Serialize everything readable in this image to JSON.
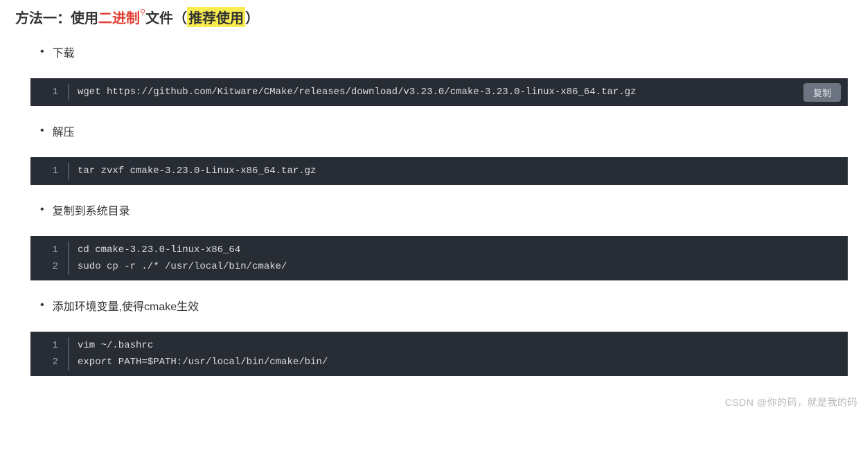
{
  "heading": {
    "prefix": "方法一：使用",
    "keyword": "二进制",
    "afterKeyword": "文件（",
    "highlighted": "推荐使用",
    "suffix": "）"
  },
  "copy_label": "复制",
  "sections": [
    {
      "bullet": "下载",
      "showCopy": true,
      "lines": [
        "wget https://github.com/Kitware/CMake/releases/download/v3.23.0/cmake-3.23.0-linux-x86_64.tar.gz"
      ]
    },
    {
      "bullet": "解压",
      "showCopy": false,
      "lines": [
        "tar zvxf cmake-3.23.0-Linux-x86_64.tar.gz"
      ]
    },
    {
      "bullet": "复制到系统目录",
      "showCopy": false,
      "lines": [
        "cd cmake-3.23.0-linux-x86_64",
        "sudo cp -r ./* /usr/local/bin/cmake/"
      ]
    },
    {
      "bullet": "添加环境变量,使得cmake生效",
      "showCopy": false,
      "lines": [
        "vim ~/.bashrc",
        "export PATH=$PATH:/usr/local/bin/cmake/bin/"
      ]
    }
  ],
  "watermark": "CSDN @你的码，就是我的码"
}
